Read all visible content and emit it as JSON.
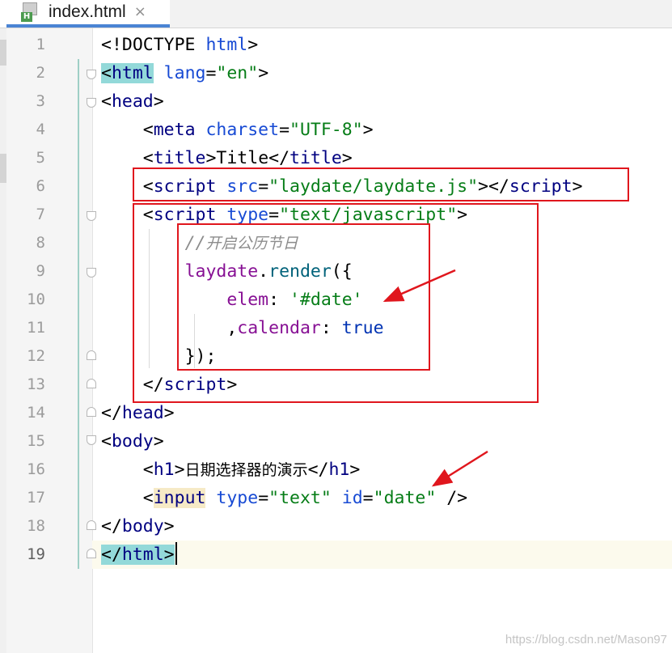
{
  "tab": {
    "file_name": "index.html",
    "file_badge": "H",
    "close_glyph": "×"
  },
  "editor": {
    "current_line": 19,
    "line_numbers": [
      "1",
      "2",
      "3",
      "4",
      "5",
      "6",
      "7",
      "8",
      "9",
      "10",
      "11",
      "12",
      "13",
      "14",
      "15",
      "16",
      "17",
      "18",
      "19"
    ],
    "lines": {
      "l1": {
        "doctype": "<!DOCTYPE ",
        "html": "html",
        "gt": ">"
      },
      "l2": {
        "lt": "<",
        "html": "html",
        "lang_attr": " lang",
        "eq": "=",
        "lang_val": "\"en\"",
        "gt": ">"
      },
      "l3": {
        "lt": "<",
        "tag": "head",
        "gt": ">"
      },
      "l4": {
        "lt": "<",
        "tag": "meta",
        "attr": " charset",
        "eq": "=",
        "val": "\"UTF-8\"",
        "gt": ">"
      },
      "l5": {
        "lt": "<",
        "tag": "title",
        "gt": ">",
        "text": "Title",
        "lt_close": "</",
        "tag_close": "title",
        "gt_close": ">"
      },
      "l6": {
        "lt": "<",
        "tag": "script",
        "attr": " src",
        "eq": "=",
        "val": "\"laydate/laydate.js\"",
        "gt": ">",
        "lt_close": "</",
        "tag_close": "script",
        "gt_close": ">"
      },
      "l7": {
        "lt": "<",
        "tag": "script",
        "attr": " type",
        "eq": "=",
        "val": "\"text/javascript\"",
        "gt": ">"
      },
      "l8": {
        "slashes": "//",
        "comment": "开启公历节日"
      },
      "l9": {
        "obj": "laydate",
        "dot": ".",
        "fn": "render",
        "paren": "({"
      },
      "l10": {
        "key": "elem",
        "colon": ": ",
        "val": "'#date'"
      },
      "l11": {
        "comma": ",",
        "key": "calendar",
        "colon": ": ",
        "val": "true"
      },
      "l12": {
        "close": "});"
      },
      "l13": {
        "lt": "</",
        "tag": "script",
        "gt": ">"
      },
      "l14": {
        "lt": "</",
        "tag": "head",
        "gt": ">"
      },
      "l15": {
        "lt": "<",
        "tag": "body",
        "gt": ">"
      },
      "l16": {
        "lt": "<",
        "tag": "h1",
        "gt": ">",
        "text": "日期选择器的演示",
        "lt_close": "</",
        "tag_close": "h1",
        "gt_close": ">"
      },
      "l17": {
        "lt": "<",
        "tag": "input",
        "type_attr": " type",
        "eq1": "=",
        "type_val": "\"text\"",
        "id_attr": " id",
        "eq2": "=",
        "id_val": "\"date\"",
        "end": " />"
      },
      "l18": {
        "lt": "</",
        "tag": "body",
        "gt": ">"
      },
      "l19": {
        "lt": "</",
        "tag": "html",
        "gt": ">"
      }
    }
  },
  "colors": {
    "tag": "#000080",
    "attribute": "#174ad4",
    "string": "#067d17",
    "keyword": "#0033b3",
    "field": "#871094",
    "function": "#00627a",
    "comment": "#8c8c8c",
    "annotation": "#e0161d",
    "tab_underline": "#4a84d4"
  },
  "watermark": "https://blog.csdn.net/Mason97"
}
